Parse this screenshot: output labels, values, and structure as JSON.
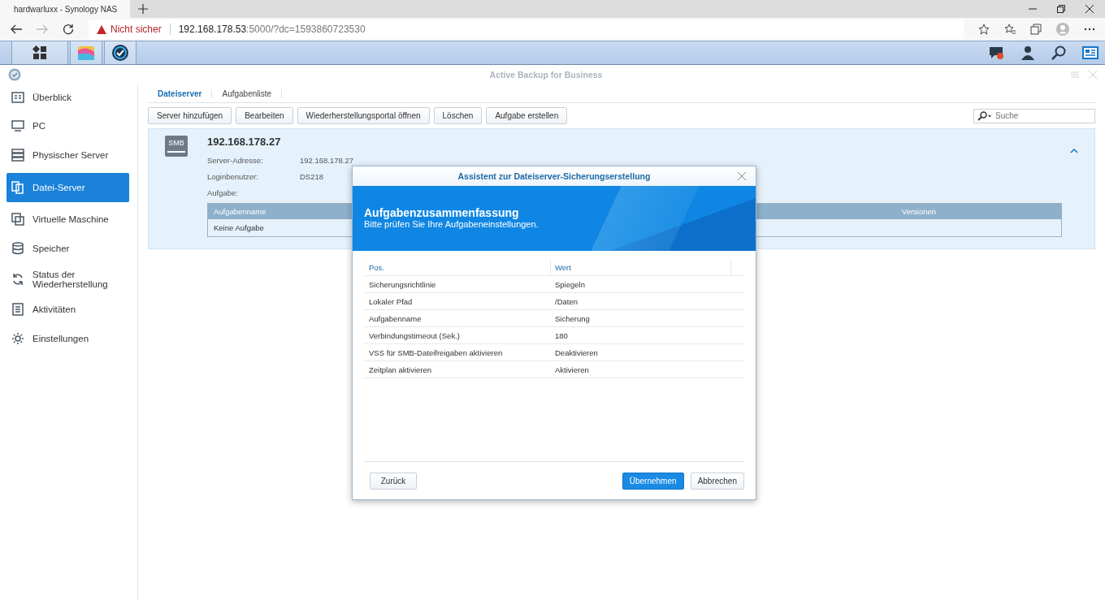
{
  "browser": {
    "tab_title": "hardwarluxx - Synology NAS",
    "security": "Nicht sicher",
    "url_host": "192.168.178.53",
    "url_rest": ":5000/?dc=1593860723530"
  },
  "window": {
    "title": "Active Backup for Business"
  },
  "sidebar": {
    "items": [
      {
        "label": "Überblick",
        "selected": false
      },
      {
        "label": "PC",
        "selected": false
      },
      {
        "label": "Physischer Server",
        "selected": false
      },
      {
        "label": "Datei-Server",
        "selected": true
      },
      {
        "label": "Virtuelle Maschine",
        "selected": false
      },
      {
        "label": "Speicher",
        "selected": false
      },
      {
        "label": "Status der Wiederherstellung",
        "selected": false
      },
      {
        "label": "Aktivitäten",
        "selected": false
      },
      {
        "label": "Einstellungen",
        "selected": false
      }
    ]
  },
  "tabs": [
    {
      "label": "Dateiserver",
      "selected": true
    },
    {
      "label": "Aufgabenliste",
      "selected": false
    }
  ],
  "toolbar": {
    "buttons": [
      "Server hinzufügen",
      "Bearbeiten",
      "Wiederherstellungsportal öffnen",
      "Löschen",
      "Aufgabe erstellen"
    ],
    "search": {
      "placeholder": "Suche"
    }
  },
  "server": {
    "badge": "SMB",
    "title": "192.168.178.27",
    "expanded": true,
    "fields": [
      {
        "label": "Server-Adresse:",
        "value": "192.168.178.27"
      },
      {
        "label": "Loginbenutzer:",
        "value": "DS218"
      },
      {
        "label": "Aufgabe:"
      }
    ],
    "table": {
      "columns": [
        "Aufgabenname",
        "Versionen"
      ],
      "empty_text": "Keine Aufgabe"
    }
  },
  "dialog": {
    "title": "Assistent zur Dateiserver-Sicherungserstellung",
    "heading": "Aufgabenzusammenfassung",
    "subheading": "Bitte prüfen Sie Ihre Aufgabeneinstellungen.",
    "columns": [
      "Pos.",
      "Wert"
    ],
    "rows": [
      {
        "item": "Sicherungsrichtlinie",
        "value": "Spiegeln"
      },
      {
        "item": "Lokaler Pfad",
        "value": "/Daten"
      },
      {
        "item": "Aufgabenname",
        "value": "Sicherung"
      },
      {
        "item": "Verbindungstimeout (Sek.)",
        "value": "180"
      },
      {
        "item": "VSS für SMB-Dateifreigaben aktivieren",
        "value": "Deaktivieren"
      },
      {
        "item": "Zeitplan aktivieren",
        "value": "Aktivieren"
      }
    ],
    "buttons": [
      {
        "label": "Zurück",
        "kind": "secondary"
      },
      {
        "label": "Übernehmen",
        "kind": "primary"
      },
      {
        "label": "Abbrechen",
        "kind": "secondary"
      }
    ]
  }
}
